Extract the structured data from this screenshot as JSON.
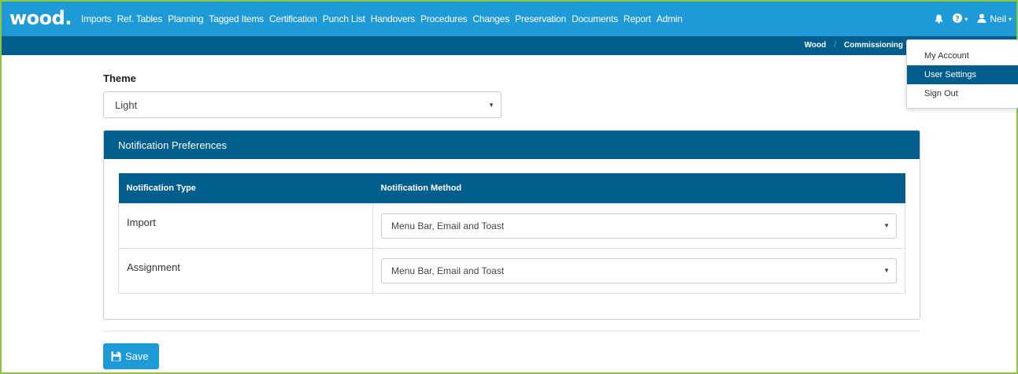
{
  "brand": {
    "logo": "wood",
    "logo_dot": "."
  },
  "nav": {
    "items": [
      "Imports",
      "Ref. Tables",
      "Planning",
      "Tagged Items",
      "Certification",
      "Punch List",
      "Handovers",
      "Procedures",
      "Changes",
      "Preservation",
      "Documents",
      "Report",
      "Admin"
    ]
  },
  "user": {
    "name": "Neil",
    "caret": "▾"
  },
  "breadcrumb": {
    "root": "Wood",
    "sep": "/",
    "current": "Commissioning"
  },
  "user_menu": {
    "items": [
      "My Account",
      "User Settings",
      "Sign Out"
    ],
    "active": "User Settings"
  },
  "theme": {
    "label": "Theme",
    "value": "Light",
    "arrow": "▼"
  },
  "notifications": {
    "title": "Notification Preferences",
    "columns": [
      "Notification Type",
      "Notification Method"
    ],
    "rows": [
      {
        "type": "Import",
        "method": "Menu Bar, Email and Toast"
      },
      {
        "type": "Assignment",
        "method": "Menu Bar, Email and Toast"
      }
    ]
  },
  "save": {
    "label": "Save"
  },
  "colors": {
    "primary": "#1e9ad6",
    "dark": "#025f8d",
    "frame": "#8cc63f"
  }
}
